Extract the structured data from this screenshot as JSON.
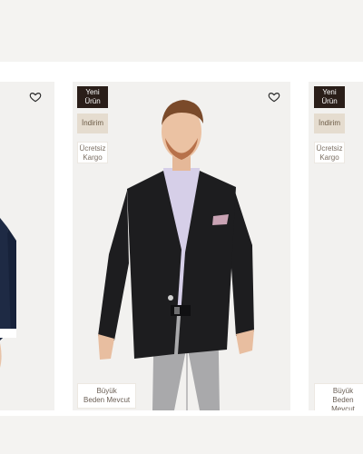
{
  "colors": {
    "page_background": "#f7f6f4",
    "card_background": "#f2f1ef",
    "badge_new_bg": "#2a1e19",
    "badge_sale_bg": "#e5dccf",
    "jacket": "#1d1d1f",
    "shirt": "#d6cfe8",
    "trousers": "#a9a9ab"
  },
  "products": [
    {
      "favorite_icon": "heart-outline-icon"
    },
    {
      "favorite_icon": "heart-outline-icon",
      "badges": {
        "new": "Yeni\nÜrün",
        "sale": "İndirim",
        "cargo": "Ücretsiz\nKargo"
      },
      "bottom_tag": "Büyük\nBeden Mevcut"
    },
    {
      "badges": {
        "new": "Yeni\nÜrün",
        "sale": "İndirim",
        "cargo": "Ücretsiz\nKargo"
      },
      "bottom_tag": "Büyük\nBeden Mevcut"
    }
  ]
}
